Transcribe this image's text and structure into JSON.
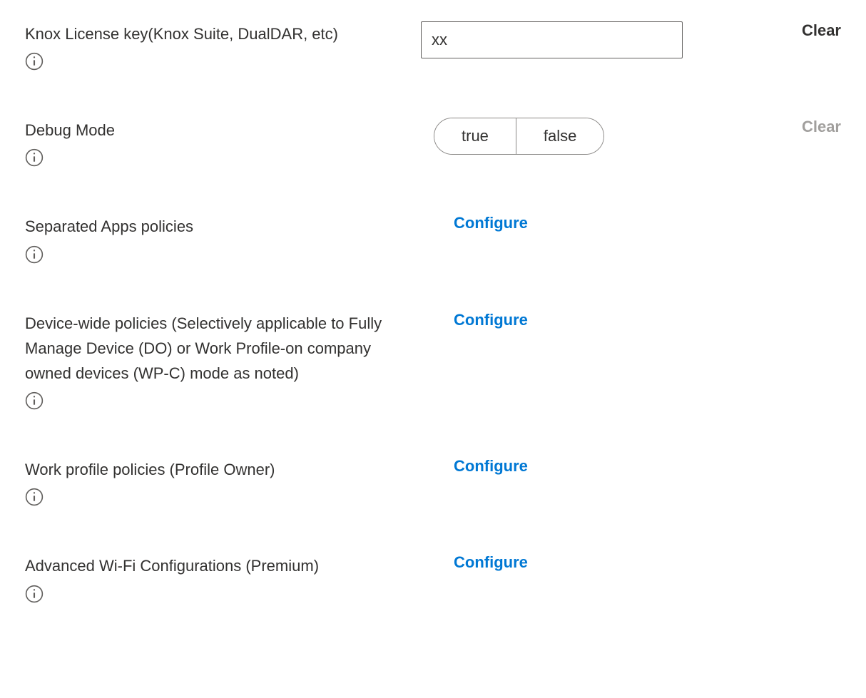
{
  "rows": {
    "knox_license": {
      "label": "Knox License key(Knox Suite, DualDAR, etc)",
      "value": "xx",
      "clear_label": "Clear"
    },
    "debug_mode": {
      "label": "Debug Mode",
      "option_true": "true",
      "option_false": "false",
      "clear_label": "Clear"
    },
    "separated_apps": {
      "label": "Separated Apps policies",
      "action": "Configure"
    },
    "device_wide": {
      "label": "Device-wide policies (Selectively applicable to Fully Manage Device (DO) or Work Profile-on company owned devices (WP-C) mode as noted)",
      "action": "Configure"
    },
    "work_profile": {
      "label": "Work profile policies (Profile Owner)",
      "action": "Configure"
    },
    "wifi": {
      "label": "Advanced Wi-Fi Configurations (Premium)",
      "action": "Configure"
    }
  }
}
